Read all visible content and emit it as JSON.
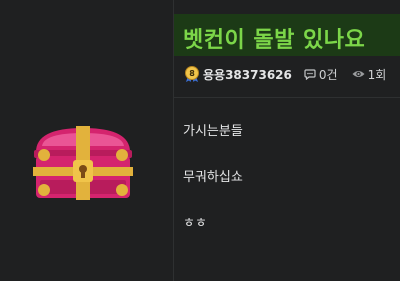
{
  "post": {
    "title": "벳컨이 돌발 있나요",
    "author": "용용38373626",
    "comments": "0건",
    "views": "1회",
    "body_lines": [
      "가시는분들",
      "무궈하십쇼",
      "ㅎㅎ"
    ]
  },
  "icons": {
    "thumbnail": "treasure-chest-icon",
    "badge": "level-medal-icon",
    "comment": "comment-icon",
    "views": "eye-icon"
  },
  "colors": {
    "background": "#1f2021",
    "title_bar": "#1c3a16",
    "title_text": "#7cd649",
    "chest_body": "#d4246e",
    "chest_trim": "#e2b23c"
  }
}
